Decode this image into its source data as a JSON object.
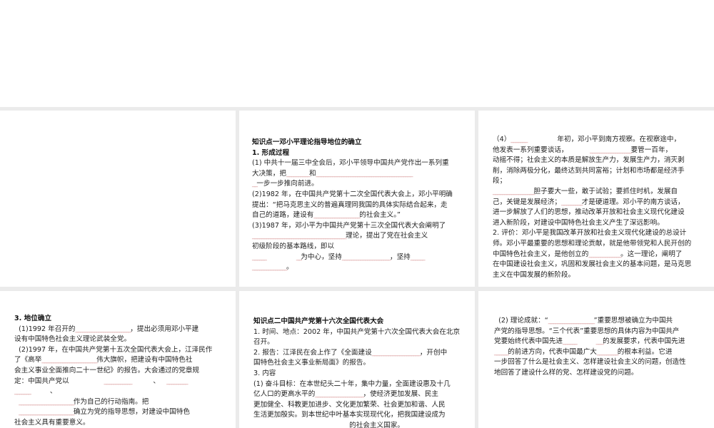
{
  "slides": [
    {
      "lines": []
    },
    {
      "lines": [
        {
          "t": "知识点一邓小平理论指导地位的确立",
          "bold": true
        },
        {
          "t": "1. 形成过程",
          "bold": true
        },
        {
          "t": "(1) 中共十一届三中全会后，邓小平领导中国共产党作出一系列重"
        },
        {
          "t": "大决策，把__________和__________________________________________"
        },
        {
          "t": "__一步一步推向前进。"
        },
        {
          "t": "(2)1982 年，在中国共产党第十二次全国代表大会上，邓小平明确"
        },
        {
          "t": "提出：“把马克思主义的普遍真理同我国的具体实际结合起来，走"
        },
        {
          "t": "自己的道路，建设有____________________的社会主义。”"
        },
        {
          "t": "(3)1987 年，邓小平为中国共产党第十三次全国代表大会阐明了"
        },
        {
          "t": "_________________________________________理论，提出了党在社会主义"
        },
        {
          "t": "初级阶段的基本路线，即以"
        },
        {
          "t": "______              __为中心，坚持_____________________，坚持______"
        },
        {
          "t": "_______________。"
        }
      ]
    },
    {
      "lines": [
        {
          "t": "（4）_______              年初，邓小平到南方视察。在视察途中，"
        },
        {
          "t": "他发表一系列重要谈话，          __________________要管一百年，"
        },
        {
          "t": "动摇不得；社会主义的本质是解放生产力，发展生产力，消灭剥"
        },
        {
          "t": "削，消除两极分化，最终达到共同富裕；计划和市场都是经济手"
        },
        {
          "t": "段；"
        },
        {
          "t": "__________________胆子要大一些，敢于试验；要抓住时机，发展自"
        },
        {
          "t": "己，关键是发展经济；_________才是硬道理。邓小平的南方谈话，"
        },
        {
          "t": "进一步解放了人们的思想，推动改革开放和社会主义现代化建设"
        },
        {
          "t": "进入新阶段，对建设中国特色社会主义产生了深远影响。"
        },
        {
          "t": "2. 评价：邓小平是我国改革开放和社会主义现代化建设的总设计"
        },
        {
          "t": "师。邓小平最重要的思想和理论贡献，就是他带领党和人民开创的"
        },
        {
          "t": "中国特色社会主义，是他创立的______________。这一理论，阐明了"
        },
        {
          "t": "在中国建设社会主义，巩固和发展社会主义的基本问题，是马克思"
        },
        {
          "t": "主义在中国发展的新阶段。"
        }
      ]
    },
    {
      "lines": [
        {
          "t": "3. 地位确立",
          "bold": true
        },
        {
          "t": "  (1)1992 年召开的________________________，提出必须用邓小平建"
        },
        {
          "t": "设有中国特色社会主义理论武装全党。"
        },
        {
          "t": "  (2)1997 年，在中国共产党第十五次全国代表大会上，江泽民作"
        },
        {
          "t": "了《高举________________________伟大旗帜，把建设有中国特色社"
        },
        {
          "t": "会主义事业全面推向二十一世纪》的报告。大会通过的党章规"
        },
        {
          "t": "定：中国共产党以                ____________          、   _________"
        },
        {
          "t": "_______         、"
        },
        {
          "t": "  ________________________作为自己的行动指南。把"
        },
        {
          "t": "  ________________________确立为党的指导思想，对建设中国特色"
        },
        {
          "t": "社会主义具有重要意义。"
        }
      ]
    },
    {
      "lines": [
        {
          "t": "知识点二中国共产党第十六次全国代表大会",
          "bold": true
        },
        {
          "t": "1. 时间、地点：2002 年，中国共产党第十六次全国代表大会在北京"
        },
        {
          "t": "召开。"
        },
        {
          "t": "2. 报告：江泽民在会上作了《全面建设_____________________，开创中"
        },
        {
          "t": "国特色社会主义事业新局面》的报告。"
        },
        {
          "t": "3. 内容"
        },
        {
          "t": "(1) 奋斗目标：在本世纪头二十年，集中力量，全面建设惠及十几"
        },
        {
          "t": "亿人口的更高水平的_____________________，使经济更加发展、民主"
        },
        {
          "t": "更加健全、科教更加进步、文化更加繁荣、社会更加和谐、人民"
        },
        {
          "t": "生活更加殷实。到本世纪中叶基本实现现代化，把我国建设成为"
        },
        {
          "t": "                                            的社会主义国家。"
        }
      ]
    },
    {
      "lines": [
        {
          "t": "  (2) 理论成就：“____________________”重要思想被确立为中国共"
        },
        {
          "t": "产党的指导思想。“三个代表”重要思想的具体内容为中国共产"
        },
        {
          "t": "党要始终代表中国先进______         ___的发展要求，代表中国先进"
        },
        {
          "t": "______的前进方向，代表中国最广大_________的根本利益。它进"
        },
        {
          "t": "一步回答了什么是社会主义、怎样建设社会主义的问题，创造性"
        },
        {
          "t": "地回答了建设什么样的党、怎样建设党的问题。"
        }
      ]
    }
  ]
}
